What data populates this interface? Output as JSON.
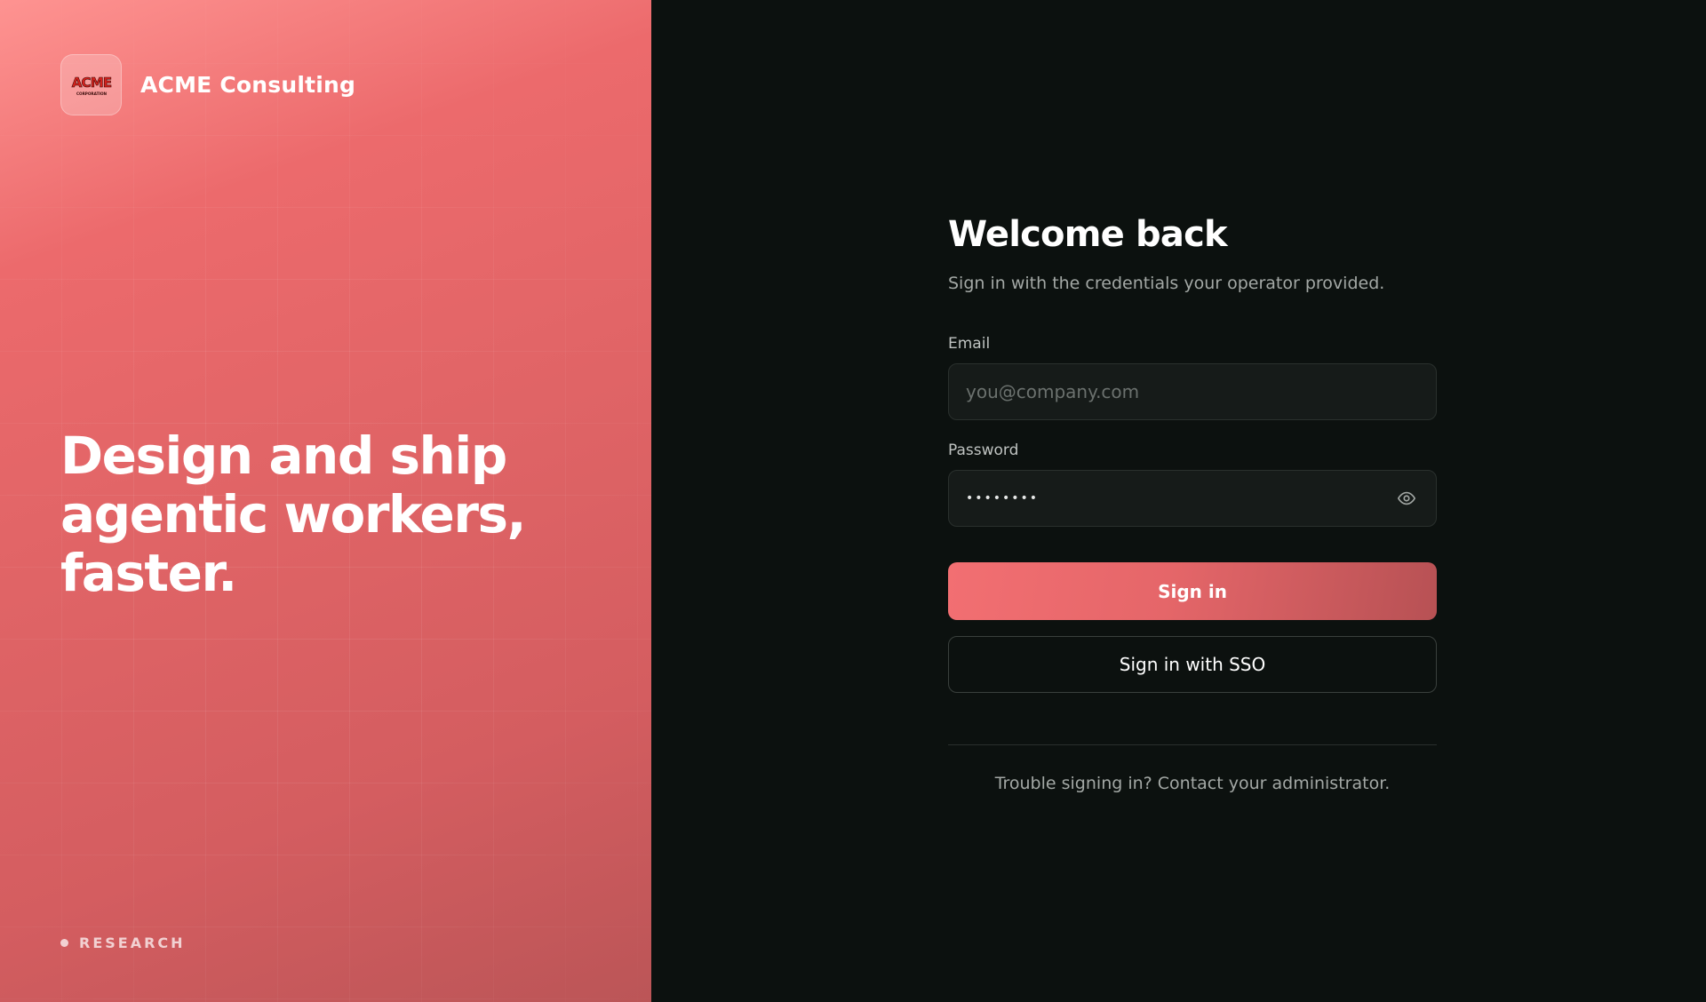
{
  "brand": {
    "name": "ACME Consulting",
    "logo_text": "ACME",
    "logo_subtext": "CORPORATION",
    "logo_color": "#d8221d",
    "panel_colors": [
      "#fe9391",
      "#e06466",
      "#bb5557"
    ]
  },
  "hero": {
    "headline": "Design and ship agentic workers, faster."
  },
  "footer_tag": {
    "label": "RESEARCH"
  },
  "form": {
    "title": "Welcome back",
    "subtitle": "Sign in with the credentials your operator provided.",
    "email": {
      "label": "Email",
      "placeholder": "you@company.com",
      "value": ""
    },
    "password": {
      "label": "Password",
      "value": "••••••••",
      "toggle_icon": "eye-icon"
    },
    "sign_in_label": "Sign in",
    "sso_label": "Sign in with SSO",
    "help_text": "Trouble signing in? Contact your administrator.",
    "accent_color": "#e56669",
    "background_color": "#0c110f"
  }
}
